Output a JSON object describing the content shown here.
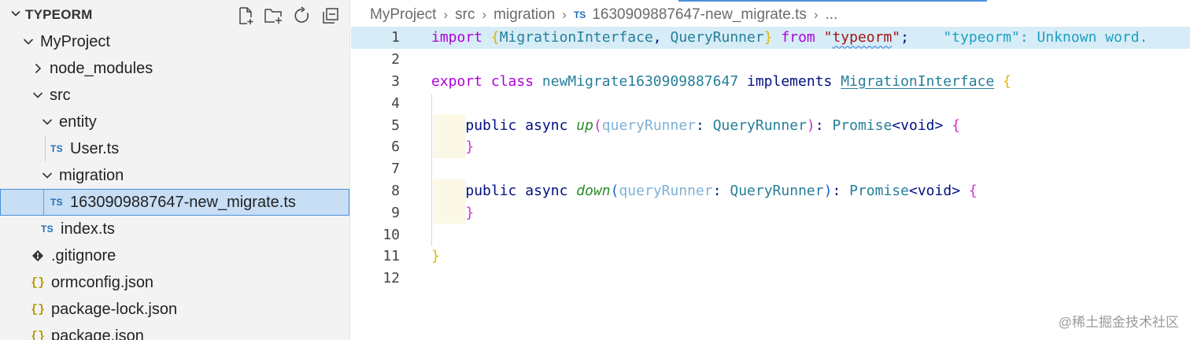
{
  "explorer": {
    "title": "TYPEORM",
    "actions": [
      "new-file-icon",
      "new-folder-icon",
      "refresh-icon",
      "collapse-all-icon"
    ],
    "tree": [
      {
        "label": "MyProject",
        "kind": "folder",
        "open": true,
        "depth": 0
      },
      {
        "label": "node_modules",
        "kind": "folder",
        "open": false,
        "depth": 1
      },
      {
        "label": "src",
        "kind": "folder",
        "open": true,
        "depth": 1
      },
      {
        "label": "entity",
        "kind": "folder",
        "open": true,
        "depth": 2
      },
      {
        "label": "User.ts",
        "kind": "ts",
        "depth": 3,
        "badge": "TS"
      },
      {
        "label": "migration",
        "kind": "folder",
        "open": true,
        "depth": 2
      },
      {
        "label": "1630909887647-new_migrate.ts",
        "kind": "ts",
        "depth": 3,
        "badge": "TS",
        "selected": true
      },
      {
        "label": "index.ts",
        "kind": "ts",
        "depth": 2,
        "badge": "TS"
      },
      {
        "label": ".gitignore",
        "kind": "git",
        "depth": 1
      },
      {
        "label": "ormconfig.json",
        "kind": "json",
        "depth": 1,
        "badge": "{}"
      },
      {
        "label": "package-lock.json",
        "kind": "json",
        "depth": 1,
        "badge": "{}"
      },
      {
        "label": "package.json",
        "kind": "json",
        "depth": 1,
        "badge": "{}"
      }
    ]
  },
  "breadcrumb": {
    "items": [
      "MyProject",
      "src",
      "migration"
    ],
    "file_badge": "TS",
    "file": "1630909887647-new_migrate.ts",
    "more": "..."
  },
  "editor": {
    "line_numbers": [
      "1",
      "2",
      "3",
      "4",
      "5",
      "6",
      "7",
      "8",
      "9",
      "10",
      "11",
      "12"
    ],
    "diagnostic": "\"typeorm\": Unknown word."
  },
  "watermark": "@稀土掘金技术社区",
  "colors": {
    "selection": "#c7def5",
    "selection_border": "#4a8fd8",
    "line_highlight": "#d6ecf7",
    "keyword_purple": "#af00db",
    "keyword_blue": "#0000ff",
    "type_teal": "#267f99"
  }
}
